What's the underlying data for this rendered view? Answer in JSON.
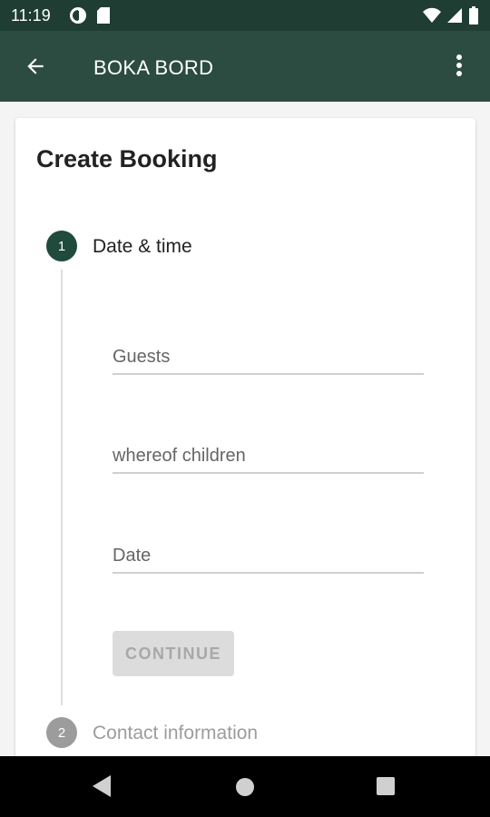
{
  "status_bar": {
    "time": "11:19",
    "icons": [
      "data-saver-icon",
      "sd-card-icon",
      "wifi-icon",
      "signal-icon",
      "battery-icon"
    ]
  },
  "app_bar": {
    "title": "BOKA BORD",
    "back_icon": "arrow-left-icon",
    "menu_icon": "more-vert-icon"
  },
  "card": {
    "title": "Create Booking"
  },
  "stepper": {
    "steps": [
      {
        "number": "1",
        "label": "Date & time",
        "active": true
      },
      {
        "number": "2",
        "label": "Contact information",
        "active": false
      }
    ]
  },
  "form": {
    "guests": {
      "placeholder": "Guests",
      "value": ""
    },
    "children": {
      "placeholder": "whereof children",
      "value": ""
    },
    "date": {
      "placeholder": "Date",
      "value": ""
    },
    "continue_label": "CONTINUE"
  },
  "nav": {
    "icons": [
      "back-triangle-icon",
      "home-circle-icon",
      "recents-square-icon"
    ]
  },
  "colors": {
    "status_bar": "#1f3d33",
    "app_bar": "#2c4b41",
    "accent": "#1f4a3c",
    "disabled": "#9c9c9c"
  }
}
